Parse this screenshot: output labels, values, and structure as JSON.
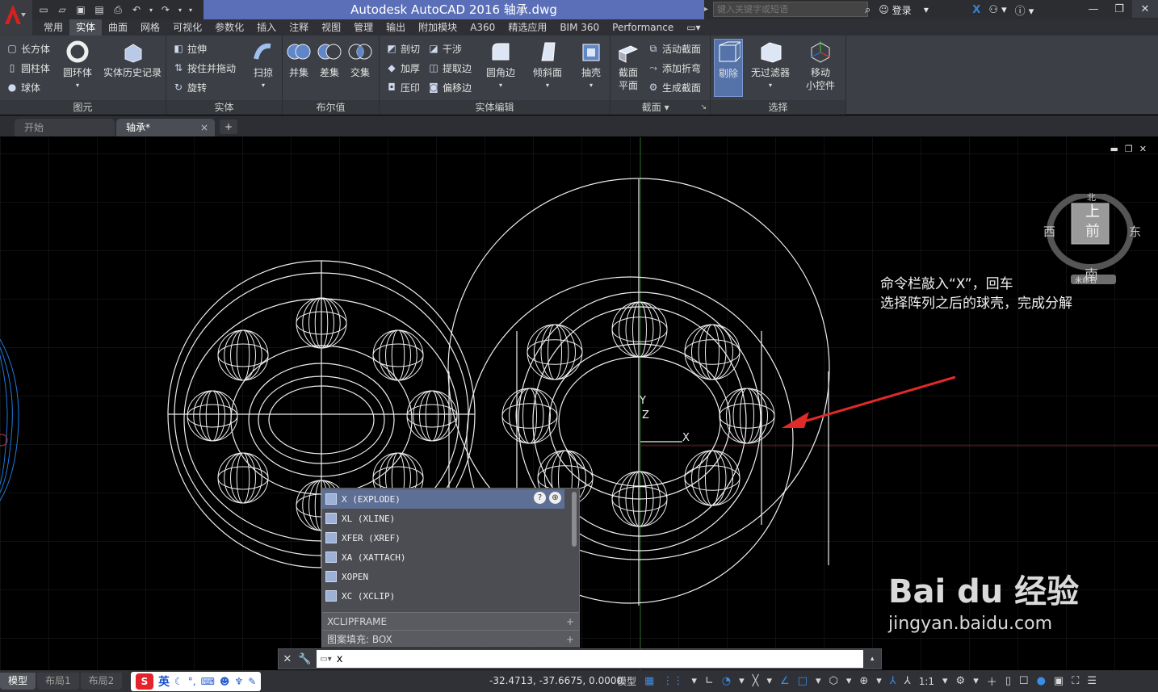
{
  "app": {
    "title": "Autodesk AutoCAD 2016    轴承.dwg",
    "search_placeholder": "键入关键字或短语",
    "login_label": "登录"
  },
  "ribbon_tabs": [
    "常用",
    "实体",
    "曲面",
    "网格",
    "可视化",
    "参数化",
    "插入",
    "注释",
    "视图",
    "管理",
    "输出",
    "附加模块",
    "A360",
    "精选应用",
    "BIM 360",
    "Performance"
  ],
  "ribbon_active_tab": "实体",
  "panels": {
    "primitives": {
      "title": "图元",
      "small": [
        "长方体",
        "圆柱体",
        "球体"
      ],
      "large": [
        "圆环体",
        "实体历史记录"
      ]
    },
    "solid": {
      "title": "实体",
      "small": [
        "拉伸",
        "按住并拖动",
        "旋转"
      ],
      "large": [
        "扫掠"
      ]
    },
    "boolean": {
      "title": "布尔值",
      "large": [
        "并集",
        "差集",
        "交集"
      ]
    },
    "solid_edit": {
      "title": "实体编辑",
      "small": [
        "剖切",
        "干涉",
        "加厚",
        "提取边",
        "压印",
        "偏移边"
      ],
      "large": [
        "圆角边",
        "倾斜面",
        "抽壳"
      ]
    },
    "section": {
      "title": "截面",
      "large": [
        "截面\n平面"
      ],
      "small": [
        "活动截面",
        "添加折弯",
        "生成截面"
      ]
    },
    "selection": {
      "title": "选择",
      "large": [
        "剔除",
        "无过滤器",
        "移动\n小控件"
      ]
    }
  },
  "doc_tabs": [
    {
      "label": "开始",
      "active": false
    },
    {
      "label": "轴承*",
      "active": true
    }
  ],
  "viewcube": {
    "top": "上",
    "front": "前",
    "west": "西",
    "east": "东",
    "south": "南",
    "north": "北",
    "ucs_label": "未命名"
  },
  "annotation": {
    "line1": "命令栏敲入“X”，回车",
    "line2": "选择阵列之后的球壳，完成分解"
  },
  "ucs_icon": {
    "y": "Y",
    "z": "Z",
    "x": "X"
  },
  "watermark": {
    "brand": "Bai  du 经验",
    "url": "jingyan.baidu.com"
  },
  "autocomplete": {
    "items": [
      "X (EXPLODE)",
      "XL (XLINE)",
      "XFER (XREF)",
      "XA (XATTACH)",
      "XOPEN",
      "XC (XCLIP)"
    ],
    "sections": [
      "XCLIPFRAME",
      "图案填充: BOX"
    ]
  },
  "command_line": {
    "value": "x"
  },
  "status": {
    "layout_tabs": [
      {
        "label": "模型",
        "active": true
      },
      {
        "label": "布局1",
        "active": false
      },
      {
        "label": "布局2",
        "active": false
      }
    ],
    "ime_label": "英",
    "coordinates": "-32.4713, -37.6675, 0.0000",
    "model_label": "模型",
    "scale": "1:1"
  },
  "colors": {
    "accent": "#5a6fb8",
    "ribbon": "#3c3f45",
    "drawing_lines": "#ffffff",
    "red_arrow": "#e02a2a",
    "blue_geometry": "#1f7be0"
  }
}
